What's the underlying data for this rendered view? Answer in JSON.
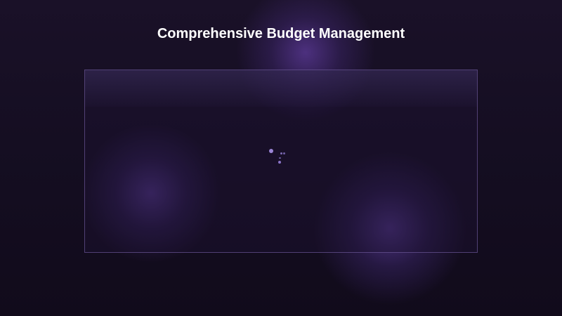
{
  "page": {
    "title": "Comprehensive Budget Management"
  },
  "panel": {
    "state": "loading",
    "loader_icon": "loading-spinner-icon"
  },
  "colors": {
    "background": "#150e22",
    "accent_glow": "#7850c8",
    "panel_border": "#8269b4",
    "title_text": "#ffffff"
  }
}
